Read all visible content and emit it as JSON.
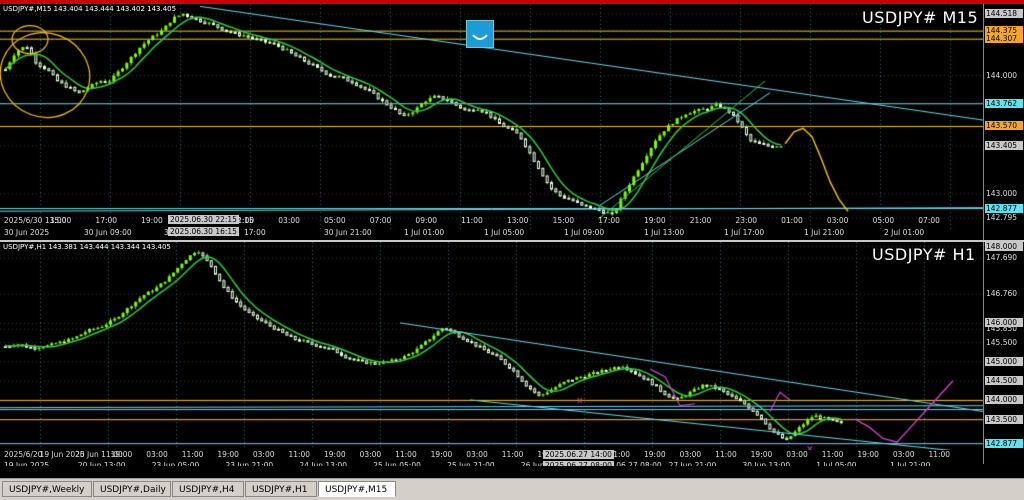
{
  "window": {
    "tabs": [
      {
        "label": "USDJPY#,Weekly",
        "active": false
      },
      {
        "label": "USDJPY#,Daily",
        "active": false
      },
      {
        "label": "USDJPY#,H4",
        "active": false
      },
      {
        "label": "USDJPY#,H1",
        "active": false
      },
      {
        "label": "USDJPY#,M15",
        "active": true
      }
    ]
  },
  "colors": {
    "bull": "#7CFC00",
    "bear": "#E0FFE0",
    "ma": "#2ecc40",
    "cyan": "#66d9e8",
    "gold": "#f5c400",
    "magenta": "#d13fd1",
    "orange_tag": "#f5a623",
    "cyan_tag": "#5ee3f0"
  },
  "chart_data": [
    {
      "type": "candlestick",
      "symbol_info": "USDJPY#,M15  143.404 143.444 143.402 143.405",
      "big_label": "USDJPY# M15",
      "ylim": [
        142.7,
        144.6
      ],
      "price_ticks": [
        "144.518",
        "144.375",
        "144.307",
        "144.000",
        "143.762",
        "143.570",
        "143.405",
        "143.000",
        "142.877",
        "142.795"
      ],
      "price_ticks_values": [
        144.518,
        144.375,
        144.307,
        144.0,
        143.762,
        143.57,
        143.405,
        143.0,
        142.877,
        142.795
      ],
      "tags": [
        {
          "text": "144.518",
          "value": 144.518,
          "color": "#c8c8c8"
        },
        {
          "text": "144.375",
          "value": 144.375,
          "color": "#f5a623"
        },
        {
          "text": "144.307",
          "value": 144.307,
          "color": "#f5a623"
        },
        {
          "text": "143.762",
          "value": 143.762,
          "color": "#5ee3f0"
        },
        {
          "text": "143.570",
          "value": 143.57,
          "color": "#f5a623"
        },
        {
          "text": "143.405",
          "value": 143.405,
          "color": "#c8c8c8"
        },
        {
          "text": "142.877",
          "value": 142.877,
          "color": "#5ee3f0"
        }
      ],
      "time_ticks": [
        "2025/6/30 13:00",
        "15:00",
        "17:00",
        "19:00",
        "2025.06.30 22:15",
        "01:00",
        "03:00",
        "05:00",
        "07:00",
        "09:00",
        "11:00",
        "13:00",
        "15:00",
        "17:00",
        "19:00",
        "21:00",
        "23:00",
        "01:00",
        "03:00",
        "05:00",
        "07:00"
      ],
      "date_ticks": [
        "30 Jun 2025",
        "30 Jun 09:00",
        "30 Jun 16:15",
        "17:00",
        "30 Jun 21:00",
        "1 Jul 01:00",
        "1 Jul 05:00",
        "1 Jul 09:00",
        "1 Jul 13:00",
        "1 Jul 17:00",
        "1 Jul 21:00",
        "2 Jul 01:00"
      ],
      "highlight_top": "2025.06.30 22:15",
      "highlight_bottom": "2025.06.30 16:15",
      "close_series": [
        144.05,
        144.2,
        144.25,
        144.1,
        144.05,
        143.95,
        143.9,
        143.85,
        143.9,
        143.95,
        143.95,
        144.05,
        144.15,
        144.25,
        144.32,
        144.38,
        144.48,
        144.52,
        144.48,
        144.45,
        144.42,
        144.38,
        144.35,
        144.33,
        144.3,
        144.28,
        144.25,
        144.2,
        144.15,
        144.1,
        144.05,
        144.0,
        143.98,
        143.95,
        143.9,
        143.85,
        143.78,
        143.72,
        143.65,
        143.7,
        143.78,
        143.82,
        143.8,
        143.75,
        143.7,
        143.72,
        143.68,
        143.6,
        143.55,
        143.5,
        143.35,
        143.2,
        143.05,
        142.98,
        142.95,
        142.9,
        142.88,
        142.85,
        142.82,
        143.0,
        143.15,
        143.3,
        143.45,
        143.55,
        143.62,
        143.68,
        143.7,
        143.72,
        143.75,
        143.7,
        143.6,
        143.45,
        143.42,
        143.4,
        143.405
      ],
      "forecast_series": [
        143.42,
        143.52,
        143.55,
        143.48,
        143.3,
        143.1,
        142.95,
        142.85
      ],
      "hlines_gold": [
        144.375,
        144.307,
        143.57
      ],
      "hline_cyan": [
        143.762,
        142.877
      ]
    },
    {
      "type": "candlestick",
      "symbol_info": "USDJPY#,H1  143.381 143.444 143.344 143.405",
      "big_label": "USDJPY# H1",
      "ylim": [
        142.7,
        148.1
      ],
      "price_ticks": [
        "148.000",
        "147.690",
        "146.760",
        "146.000",
        "145.850",
        "145.500",
        "145.000",
        "144.500",
        "144.000",
        "143.500",
        "142.877"
      ],
      "price_ticks_values": [
        148.0,
        147.69,
        146.76,
        146.0,
        145.85,
        145.5,
        145.0,
        144.5,
        144.0,
        143.5,
        142.877
      ],
      "tags": [
        {
          "text": "148.000",
          "value": 148.0,
          "color": "#c8c8c8"
        },
        {
          "text": "146.000",
          "value": 146.0,
          "color": "#c8c8c8"
        },
        {
          "text": "145.000",
          "value": 145.0,
          "color": "#c8c8c8"
        },
        {
          "text": "144.500",
          "value": 144.5,
          "color": "#c8c8c8"
        },
        {
          "text": "144.000",
          "value": 144.0,
          "color": "#c8c8c8"
        },
        {
          "text": "143.500",
          "value": 143.5,
          "color": "#c8c8c8"
        },
        {
          "text": "142.877",
          "value": 142.877,
          "color": "#5ee3f0"
        }
      ],
      "time_ticks": [
        "2025/6/20",
        "19 Jun 2025",
        "20 Jun 11:00",
        "19:00",
        "03:00",
        "11:00",
        "19:00",
        "03:00",
        "11:00",
        "19:00",
        "03:00",
        "11:00",
        "19:00",
        "03:00",
        "11:00",
        "19:00",
        "03:00",
        "11:00",
        "19:00",
        "03:00",
        "11:00",
        "19:00",
        "03:00",
        "11:00",
        "19:00",
        "03:00",
        "11:00"
      ],
      "date_ticks": [
        "19 Jun 2025",
        "20 Jun 13:00",
        "23 Jun 05:00",
        "23 Jun 21:00",
        "24 Jun 13:00",
        "25 Jun 05:00",
        "25 Jun 21:00",
        "26 Jun 13:00",
        "2025.06.27 08:00",
        "27 Jun 21:00",
        "30 Jun 13:00",
        "1 Jul 05:00",
        "1 Jul 21:00"
      ],
      "highlight_top": "2025.06.27 14:00",
      "highlight_bottom": "2025.06.27 08:00",
      "close_series": [
        145.4,
        145.45,
        145.35,
        145.4,
        145.5,
        145.6,
        145.8,
        145.9,
        146.1,
        146.4,
        146.7,
        146.9,
        147.2,
        147.6,
        147.9,
        147.5,
        146.9,
        146.5,
        146.2,
        146.0,
        145.8,
        145.6,
        145.5,
        145.4,
        145.3,
        145.1,
        145.0,
        144.95,
        145.0,
        145.1,
        145.3,
        145.6,
        145.9,
        145.7,
        145.5,
        145.3,
        145.1,
        144.8,
        144.4,
        144.1,
        144.3,
        144.5,
        144.6,
        144.7,
        144.8,
        144.9,
        144.7,
        144.5,
        144.2,
        144.0,
        144.2,
        144.4,
        144.3,
        144.1,
        143.9,
        143.6,
        143.2,
        142.95,
        143.3,
        143.6,
        143.5,
        143.4
      ],
      "forecast_series": [
        143.5,
        143.3,
        143.0,
        142.9,
        143.3,
        143.7,
        144.1,
        144.5
      ],
      "hlines_gold": [
        144.0,
        143.5
      ],
      "hline_cyan": [
        143.762,
        142.877
      ]
    }
  ]
}
